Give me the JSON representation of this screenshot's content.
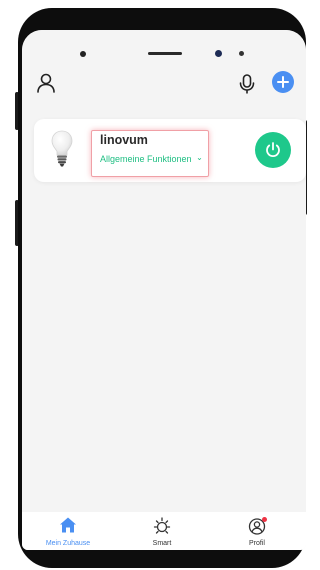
{
  "device": {
    "name": "linovum",
    "functions_label": "Allgemeine Funktionen",
    "functions_chevron": "⌄"
  },
  "bottom_nav": {
    "tabs": [
      {
        "label": "Mein Zuhause",
        "icon": "home-icon",
        "active": true
      },
      {
        "label": "Smart",
        "icon": "sun-icon",
        "active": false
      },
      {
        "label": "Profil",
        "icon": "profile-icon",
        "active": false
      }
    ]
  },
  "colors": {
    "accent_blue": "#4a8ff2",
    "power_green": "#1ec88b",
    "link_green": "#1fbf83",
    "highlight_pink": "#f0a0a6",
    "notification_red": "#ee3344"
  }
}
